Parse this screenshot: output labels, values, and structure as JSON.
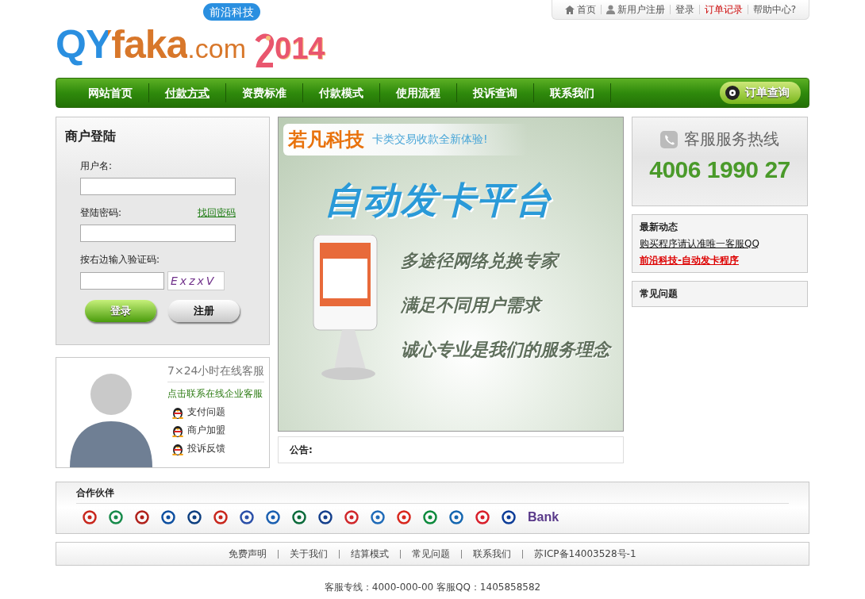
{
  "top_links": [
    {
      "label": "首页",
      "kind": "home",
      "highlight": false
    },
    {
      "label": "新用户注册",
      "kind": "user",
      "highlight": false
    },
    {
      "label": "登录",
      "kind": "text",
      "highlight": false
    },
    {
      "label": "订单记录",
      "kind": "text",
      "highlight": true
    },
    {
      "label": "帮助中心?",
      "kind": "text",
      "highlight": false
    }
  ],
  "logo": {
    "brand": "QYfaka",
    "domain": ".com",
    "badge": "前沿科技",
    "year": "014"
  },
  "nav": {
    "items": [
      {
        "label": "网站首页",
        "selected": false
      },
      {
        "label": "付款方式",
        "selected": true
      },
      {
        "label": "资费标准",
        "selected": false
      },
      {
        "label": "付款模式",
        "selected": false
      },
      {
        "label": "使用流程",
        "selected": false
      },
      {
        "label": "投诉查询",
        "selected": false
      },
      {
        "label": "联系我们",
        "selected": false
      }
    ],
    "order_button": "订单查询"
  },
  "login": {
    "title": "商户登陆",
    "username_label": "用户名:",
    "password_label": "登陆密码:",
    "forgot_link": "找回密码",
    "captcha_label": "按右边输入验证码:",
    "captcha": "ExzxV",
    "login_button": "登录",
    "register_button": "注册"
  },
  "service": {
    "title": "7×24小时在线客服",
    "link": "点击联系在线企业客服",
    "qq_links": [
      "支付问题",
      "商户加盟",
      "投诉反馈"
    ]
  },
  "banner": {
    "brand": "若凡科技",
    "tagline": "卡类交易收款全新体验!",
    "headline": "自动发卡平台",
    "slogans": [
      "多途径网络兑换专家",
      "满足不同用户需求",
      "诚心专业是我们的服务理念"
    ]
  },
  "notice": {
    "label": "公告:"
  },
  "hotline": {
    "title": "客服服务热线",
    "number": "4006 1990 27"
  },
  "news": {
    "title": "最新动态",
    "items": [
      {
        "label": "购买程序请认准唯一客服QQ",
        "highlight": false
      },
      {
        "label": "前沿科技-自动发卡程序",
        "highlight": true
      }
    ]
  },
  "faq": {
    "title": "常见问题"
  },
  "partners": {
    "title": "合作伙伴",
    "logos": [
      {
        "color": "#c8261c"
      },
      {
        "color": "#168a4a"
      },
      {
        "color": "#b0201a"
      },
      {
        "color": "#0d4fa0"
      },
      {
        "color": "#0d3f80"
      },
      {
        "color": "#c8261c"
      },
      {
        "color": "#2a4fa8"
      },
      {
        "color": "#1a5fb0"
      },
      {
        "color": "#0a6a3a"
      },
      {
        "color": "#143f8c"
      },
      {
        "color": "#d0262a"
      },
      {
        "color": "#1e6ab8"
      },
      {
        "color": "#d8261c"
      },
      {
        "color": "#0c8a3c"
      },
      {
        "color": "#1466b0"
      },
      {
        "color": "#d81e2a"
      },
      {
        "color": "#0c3c98"
      }
    ],
    "bank_text": "Bank"
  },
  "footer_links": [
    "免费声明",
    "关于我们",
    "结算模式",
    "常见问题",
    "联系我们",
    "苏ICP备14003528号-1"
  ],
  "footer_note": "客服专线：4000-000-00 客服QQ：1405858582"
}
